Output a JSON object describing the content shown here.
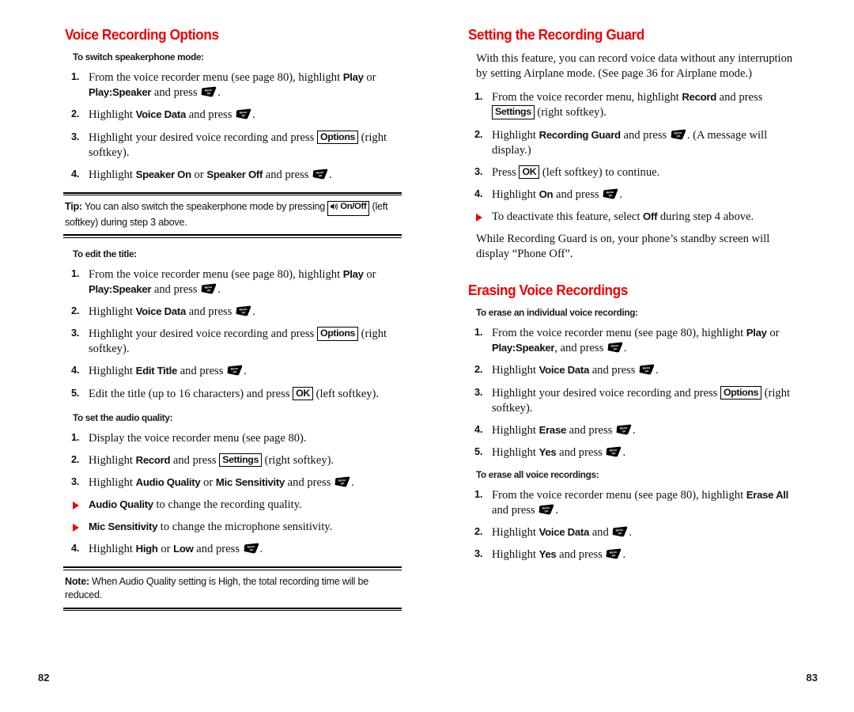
{
  "document": {
    "type": "phone-user-guide-spread",
    "accent_color": "#f00000",
    "text_color": "#111111",
    "background": "#ffffff"
  },
  "icons": {
    "menu_ok_key": "menu-ok-key-icon",
    "speaker_onoff_key": "speaker-onoff-key-icon",
    "triangle_bullet": "red-triangle-bullet-icon"
  },
  "left_page": {
    "page_number": "82",
    "sections": [
      {
        "heading": "Voice Recording Options",
        "subsections": [
          {
            "subheading": "To switch speakerphone mode:",
            "steps": [
              {
                "num": "1.",
                "parts": [
                  {
                    "t": "text",
                    "v": "From the voice recorder menu (see page 80), highlight "
                  },
                  {
                    "t": "bold",
                    "v": "Play"
                  },
                  {
                    "t": "text",
                    "v": " or "
                  },
                  {
                    "t": "bold",
                    "v": "Play:Speaker"
                  },
                  {
                    "t": "text",
                    "v": " and press "
                  },
                  {
                    "t": "menukey"
                  },
                  {
                    "t": "text",
                    "v": "."
                  }
                ]
              },
              {
                "num": "2.",
                "parts": [
                  {
                    "t": "text",
                    "v": "Highlight "
                  },
                  {
                    "t": "bold",
                    "v": "Voice Data"
                  },
                  {
                    "t": "text",
                    "v": " and press "
                  },
                  {
                    "t": "menukey"
                  },
                  {
                    "t": "text",
                    "v": "."
                  }
                ]
              },
              {
                "num": "3.",
                "parts": [
                  {
                    "t": "text",
                    "v": "Highlight your desired voice recording and press "
                  },
                  {
                    "t": "softkey",
                    "v": "Options"
                  },
                  {
                    "t": "text",
                    "v": " (right softkey)."
                  }
                ]
              },
              {
                "num": "4.",
                "parts": [
                  {
                    "t": "text",
                    "v": "Highlight "
                  },
                  {
                    "t": "bold",
                    "v": "Speaker On"
                  },
                  {
                    "t": "text",
                    "v": " or "
                  },
                  {
                    "t": "bold",
                    "v": "Speaker Off"
                  },
                  {
                    "t": "text",
                    "v": " and press "
                  },
                  {
                    "t": "menukey"
                  },
                  {
                    "t": "text",
                    "v": "."
                  }
                ]
              }
            ]
          }
        ]
      }
    ],
    "tip_box": {
      "label": "Tip:",
      "text_before_key": " You can also switch the speakerphone mode by pressing ",
      "key_label": "On/Off",
      "text_after_key": " (left softkey) during step 3 above."
    },
    "edit_title_section": {
      "subheading": "To edit the title:",
      "steps": [
        {
          "num": "1.",
          "parts": [
            {
              "t": "text",
              "v": "From the voice recorder menu (see page 80), highlight "
            },
            {
              "t": "bold",
              "v": "Play"
            },
            {
              "t": "text",
              "v": " or "
            },
            {
              "t": "bold",
              "v": "Play:Speaker"
            },
            {
              "t": "text",
              "v": " and press "
            },
            {
              "t": "menukey"
            },
            {
              "t": "text",
              "v": "."
            }
          ]
        },
        {
          "num": "2.",
          "parts": [
            {
              "t": "text",
              "v": "Highlight "
            },
            {
              "t": "bold",
              "v": "Voice Data"
            },
            {
              "t": "text",
              "v": " and press "
            },
            {
              "t": "menukey"
            },
            {
              "t": "text",
              "v": "."
            }
          ]
        },
        {
          "num": "3.",
          "parts": [
            {
              "t": "text",
              "v": "Highlight your desired voice recording and press "
            },
            {
              "t": "softkey",
              "v": "Options"
            },
            {
              "t": "text",
              "v": " (right softkey)."
            }
          ]
        },
        {
          "num": "4.",
          "parts": [
            {
              "t": "text",
              "v": "Highlight "
            },
            {
              "t": "bold",
              "v": "Edit Title"
            },
            {
              "t": "text",
              "v": " and press "
            },
            {
              "t": "menukey"
            },
            {
              "t": "text",
              "v": "."
            }
          ]
        },
        {
          "num": "5.",
          "parts": [
            {
              "t": "text",
              "v": "Edit the title (up to 16 characters) and press "
            },
            {
              "t": "softkey",
              "v": "OK"
            },
            {
              "t": "text",
              "v": " (left softkey)."
            }
          ]
        }
      ]
    },
    "audio_quality_section": {
      "subheading": "To set the audio quality:",
      "steps": [
        {
          "num": "1.",
          "parts": [
            {
              "t": "text",
              "v": "Display the voice recorder menu (see page 80)."
            }
          ]
        },
        {
          "num": "2.",
          "parts": [
            {
              "t": "text",
              "v": "Highlight "
            },
            {
              "t": "bold",
              "v": "Record"
            },
            {
              "t": "text",
              "v": " and press "
            },
            {
              "t": "softkey",
              "v": "Settings"
            },
            {
              "t": "text",
              "v": " (right softkey)."
            }
          ]
        },
        {
          "num": "3.",
          "parts": [
            {
              "t": "text",
              "v": "Highlight "
            },
            {
              "t": "bold",
              "v": "Audio Quality"
            },
            {
              "t": "text",
              "v": " or "
            },
            {
              "t": "bold",
              "v": "Mic Sensitivity"
            },
            {
              "t": "text",
              "v": " and press "
            },
            {
              "t": "menukey"
            },
            {
              "t": "text",
              "v": "."
            }
          ]
        },
        {
          "num": "bullet",
          "parts": [
            {
              "t": "bold",
              "v": "Audio Quality"
            },
            {
              "t": "text",
              "v": " to change the recording quality."
            }
          ]
        },
        {
          "num": "bullet",
          "parts": [
            {
              "t": "bold",
              "v": "Mic Sensitivity"
            },
            {
              "t": "text",
              "v": " to change the microphone sensitivity."
            }
          ]
        },
        {
          "num": "4.",
          "parts": [
            {
              "t": "text",
              "v": "Highlight "
            },
            {
              "t": "bold",
              "v": "High"
            },
            {
              "t": "text",
              "v": " or "
            },
            {
              "t": "bold",
              "v": "Low"
            },
            {
              "t": "text",
              "v": " and press "
            },
            {
              "t": "menukey"
            },
            {
              "t": "text",
              "v": "."
            }
          ]
        }
      ]
    },
    "note_box": {
      "label": "Note:",
      "text": " When Audio Quality setting is High, the total recording time will be reduced."
    }
  },
  "right_page": {
    "page_number": "83",
    "recording_guard": {
      "heading": "Setting the Recording Guard",
      "intro": "With this feature, you can record voice data without any interruption by setting Airplane mode. (See page 36 for Airplane mode.)",
      "steps": [
        {
          "num": "1.",
          "parts": [
            {
              "t": "text",
              "v": "From the voice recorder menu, highlight "
            },
            {
              "t": "bold",
              "v": "Record"
            },
            {
              "t": "text",
              "v": " and press "
            },
            {
              "t": "softkey",
              "v": "Settings"
            },
            {
              "t": "text",
              "v": " (right softkey)."
            }
          ]
        },
        {
          "num": "2.",
          "parts": [
            {
              "t": "text",
              "v": "Highlight "
            },
            {
              "t": "bold",
              "v": "Recording Guard"
            },
            {
              "t": "text",
              "v": " and press "
            },
            {
              "t": "menukey"
            },
            {
              "t": "text",
              "v": ". (A message will display.)"
            }
          ]
        },
        {
          "num": "3.",
          "parts": [
            {
              "t": "text",
              "v": "Press "
            },
            {
              "t": "softkey",
              "v": "OK"
            },
            {
              "t": "text",
              "v": " (left softkey) to continue."
            }
          ]
        },
        {
          "num": "4.",
          "parts": [
            {
              "t": "text",
              "v": "Highlight "
            },
            {
              "t": "bold",
              "v": "On"
            },
            {
              "t": "text",
              "v": " and press "
            },
            {
              "t": "menukey"
            },
            {
              "t": "text",
              "v": "."
            }
          ]
        },
        {
          "num": "bullet",
          "parts": [
            {
              "t": "text",
              "v": "To deactivate this feature, select "
            },
            {
              "t": "bold",
              "v": "Off"
            },
            {
              "t": "text",
              "v": " during step 4 above."
            }
          ]
        }
      ],
      "outro": "While Recording Guard is on, your phone’s standby screen will display “Phone Off”."
    },
    "erasing": {
      "heading": "Erasing Voice Recordings",
      "individual": {
        "subheading": "To erase an individual voice recording:",
        "steps": [
          {
            "num": "1.",
            "parts": [
              {
                "t": "text",
                "v": "From the voice recorder menu (see page 80), highlight "
              },
              {
                "t": "bold",
                "v": "Play"
              },
              {
                "t": "text",
                "v": " or "
              },
              {
                "t": "bold",
                "v": "Play:Speaker"
              },
              {
                "t": "text",
                "v": ", and press "
              },
              {
                "t": "menukey"
              },
              {
                "t": "text",
                "v": "."
              }
            ]
          },
          {
            "num": "2.",
            "parts": [
              {
                "t": "text",
                "v": "Highlight "
              },
              {
                "t": "bold",
                "v": "Voice Data"
              },
              {
                "t": "text",
                "v": " and press "
              },
              {
                "t": "menukey"
              },
              {
                "t": "text",
                "v": "."
              }
            ]
          },
          {
            "num": "3.",
            "parts": [
              {
                "t": "text",
                "v": "Highlight your desired voice recording and press "
              },
              {
                "t": "softkey",
                "v": "Options"
              },
              {
                "t": "text",
                "v": " (right softkey)."
              }
            ]
          },
          {
            "num": "4.",
            "parts": [
              {
                "t": "text",
                "v": "Highlight "
              },
              {
                "t": "bold",
                "v": "Erase"
              },
              {
                "t": "text",
                "v": " and press "
              },
              {
                "t": "menukey"
              },
              {
                "t": "text",
                "v": "."
              }
            ]
          },
          {
            "num": "5.",
            "parts": [
              {
                "t": "text",
                "v": "Highlight "
              },
              {
                "t": "bold",
                "v": "Yes"
              },
              {
                "t": "text",
                "v": " and press "
              },
              {
                "t": "menukey"
              },
              {
                "t": "text",
                "v": "."
              }
            ]
          }
        ]
      },
      "all": {
        "subheading": "To erase all voice recordings:",
        "steps": [
          {
            "num": "1.",
            "parts": [
              {
                "t": "text",
                "v": "From the voice recorder menu (see page 80), highlight "
              },
              {
                "t": "bold",
                "v": "Erase All"
              },
              {
                "t": "text",
                "v": " and press "
              },
              {
                "t": "menukey"
              },
              {
                "t": "text",
                "v": "."
              }
            ]
          },
          {
            "num": "2.",
            "parts": [
              {
                "t": "text",
                "v": "Highlight "
              },
              {
                "t": "bold",
                "v": "Voice Data"
              },
              {
                "t": "text",
                "v": " and "
              },
              {
                "t": "menukey"
              },
              {
                "t": "text",
                "v": "."
              }
            ]
          },
          {
            "num": "3.",
            "parts": [
              {
                "t": "text",
                "v": "Highlight "
              },
              {
                "t": "bold",
                "v": "Yes"
              },
              {
                "t": "text",
                "v": " and press "
              },
              {
                "t": "menukey"
              },
              {
                "t": "text",
                "v": "."
              }
            ]
          }
        ]
      }
    }
  }
}
